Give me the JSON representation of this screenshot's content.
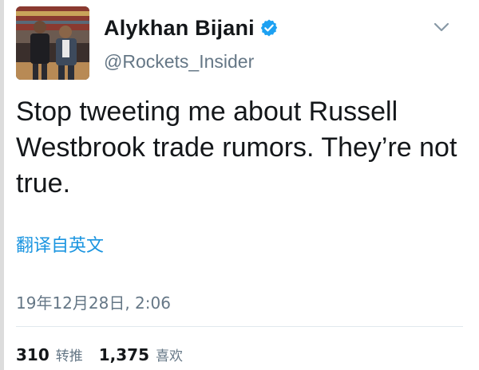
{
  "author": {
    "display_name": "Alykhan Bijani",
    "handle": "@Rockets_Insider",
    "verified": true,
    "avatar_icon": "profile-photo"
  },
  "tweet": {
    "text": "Stop tweeting me about Russell Westbrook trade rumors. They’re not true.",
    "translate_label": "翻译自英文",
    "timestamp": "19年12月28日, 2:06"
  },
  "stats": {
    "retweets_count": "310",
    "retweets_label": "转推",
    "likes_count": "1,375",
    "likes_label": "喜欢"
  },
  "icons": {
    "verified": "verified-badge-icon",
    "menu": "chevron-down-icon"
  },
  "colors": {
    "link": "#1b95e0",
    "verified": "#1da1f2",
    "secondary_text": "#657786",
    "primary_text": "#14171a"
  }
}
